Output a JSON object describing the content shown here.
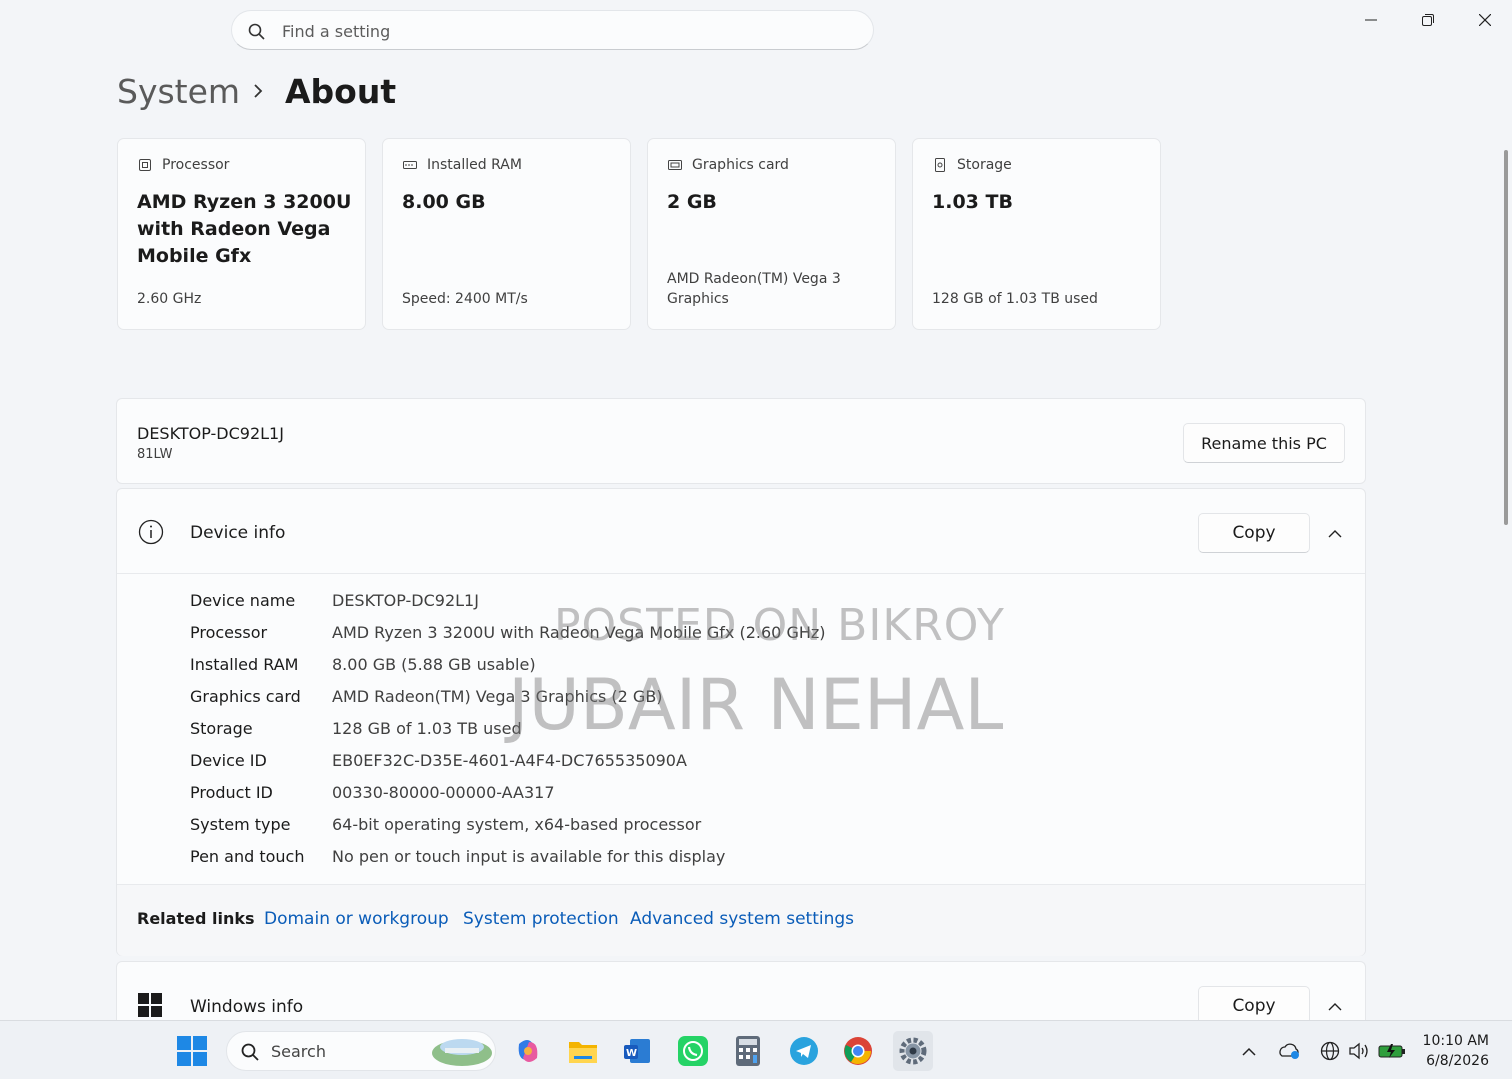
{
  "search": {
    "placeholder": "Find a setting"
  },
  "breadcrumb": {
    "parent": "System",
    "current": "About"
  },
  "cards": [
    {
      "label": "Processor",
      "value": "AMD Ryzen 3 3200U with Radeon Vega Mobile Gfx",
      "sub": "2.60 GHz",
      "icon": "processor-icon"
    },
    {
      "label": "Installed RAM",
      "value": "8.00 GB",
      "sub": "Speed: 2400 MT/s",
      "icon": "ram-icon"
    },
    {
      "label": "Graphics card",
      "value": "2 GB",
      "sub": "AMD Radeon(TM) Vega 3 Graphics",
      "icon": "graphics-card-icon"
    },
    {
      "label": "Storage",
      "value": "1.03 TB",
      "sub": "128 GB of 1.03 TB used",
      "icon": "storage-icon"
    }
  ],
  "pc": {
    "name": "DESKTOP-DC92L1J",
    "model": "81LW",
    "rename_label": "Rename this PC"
  },
  "device_info": {
    "title": "Device info",
    "copy_label": "Copy",
    "rows": [
      {
        "key": "Device name",
        "value": "DESKTOP-DC92L1J"
      },
      {
        "key": "Processor",
        "value": "AMD Ryzen 3 3200U with Radeon Vega Mobile Gfx (2.60 GHz)"
      },
      {
        "key": "Installed RAM",
        "value": "8.00 GB (5.88 GB usable)"
      },
      {
        "key": "Graphics card",
        "value": "AMD Radeon(TM) Vega 3 Graphics (2 GB)"
      },
      {
        "key": "Storage",
        "value": "128 GB of 1.03 TB used"
      },
      {
        "key": "Device ID",
        "value": "EB0EF32C-D35E-4601-A4F4-DC765535090A"
      },
      {
        "key": "Product ID",
        "value": "00330-80000-00000-AA317"
      },
      {
        "key": "System type",
        "value": "64-bit operating system, x64-based processor"
      },
      {
        "key": "Pen and touch",
        "value": "No pen or touch input is available for this display"
      }
    ]
  },
  "related": {
    "label": "Related links",
    "links": [
      "Domain or workgroup",
      "System protection",
      "Advanced system settings"
    ]
  },
  "windows_info": {
    "title": "Windows info",
    "copy_label": "Copy"
  },
  "watermark": {
    "line1": "POSTED ON BIKROY",
    "line2": "JUBAIR NEHAL"
  },
  "taskbar": {
    "search_label": "Search",
    "time": "10:10 AM",
    "date": "6/8/2026"
  },
  "colors": {
    "accent": "#0a5cb8",
    "background": "#f3f5f8",
    "card": "#fbfcfd"
  }
}
